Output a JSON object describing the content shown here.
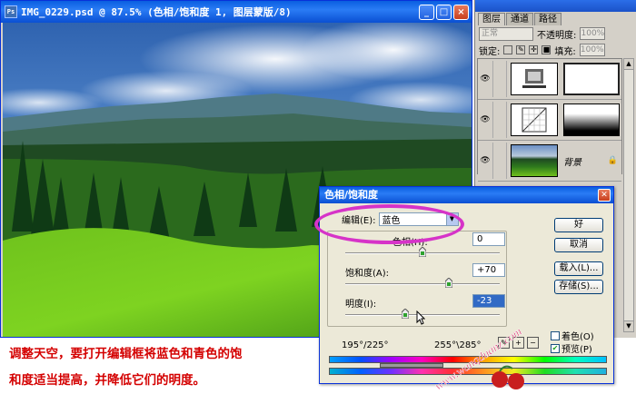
{
  "doc_window": {
    "title": "IMG_0229.psd @ 87.5% (色相/饱和度 1, 图层蒙版/8)",
    "icon_label": "Ps",
    "controls": [
      "_",
      "□",
      "×"
    ]
  },
  "layers_panel": {
    "tabs": [
      {
        "label": "图层"
      },
      {
        "label": "通道"
      },
      {
        "label": "路径"
      }
    ],
    "blend_mode": "正常",
    "opacity_label": "不透明度:",
    "opacity_value": "100%",
    "lock_label": "锁定:",
    "fill_label": "填充:",
    "fill_value": "100%",
    "layers": [
      {
        "type": "adjustment"
      },
      {
        "type": "adjustment"
      },
      {
        "type": "image",
        "name": "背景"
      }
    ]
  },
  "hue_dialog": {
    "title": "色相/饱和度",
    "edit_label": "编辑(E):",
    "edit_value": "蓝色",
    "hue_label": "色相(H):",
    "hue_value": "0",
    "saturation_label": "饱和度(A):",
    "saturation_value": "+70",
    "lightness_label": "明度(I):",
    "lightness_value": "-23",
    "ok_label": "好",
    "cancel_label": "取消",
    "load_label": "载入(L)...",
    "save_label": "存储(S)...",
    "colorize_label": "着色(O)",
    "preview_label": "预览(P)",
    "preview_checked": true,
    "colorize_checked": false,
    "range_left": "195°/225°",
    "range_right": "255°\\285°",
    "hue_slider": 0.5,
    "saturation_slider": 0.67,
    "lightness_slider": 0.39
  },
  "caption": {
    "line1": "调整天空，要打开编辑框将蓝色和青色的饱",
    "line2": "和度适当提高，并降低它们的明度。"
  },
  "watermark": {
    "text": "www.wanqduanz.com"
  },
  "colors": {
    "xp_blue": "#0a5fe0",
    "caption_red": "#d40000",
    "highlight_magenta": "#d633c8"
  }
}
